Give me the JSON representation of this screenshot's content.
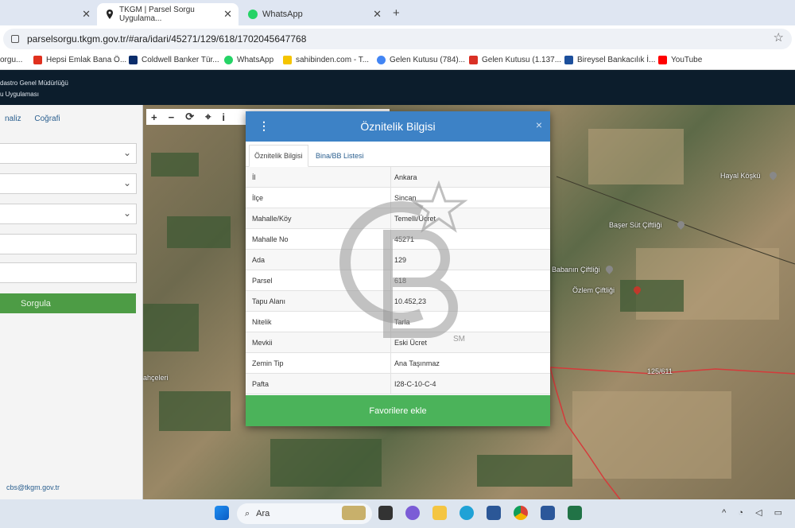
{
  "browser": {
    "tabs": [
      {
        "label": "",
        "active": false
      },
      {
        "label": "TKGM | Parsel Sorgu Uygulama...",
        "active": true
      },
      {
        "label": "WhatsApp",
        "active": false
      }
    ],
    "new_tab": "+",
    "close_glyph": "✕",
    "url": "parselsorgu.tkgm.gov.tr/#ara/idari/45271/129/618/1702045647768",
    "star": "☆",
    "bookmarks": [
      {
        "label": "orgu...",
        "color": "#888"
      },
      {
        "label": "Hepsi Emlak Bana Ö...",
        "color": "#e0301e"
      },
      {
        "label": "Coldwell Banker Tür...",
        "color": "#0b2d6b"
      },
      {
        "label": "WhatsApp",
        "color": "#25d366"
      },
      {
        "label": "sahibinden.com - T...",
        "color": "#f5c400"
      },
      {
        "label": "Gelen Kutusu (784)...",
        "color": "#4285f4"
      },
      {
        "label": "Gelen Kutusu (1.137...",
        "color": "#d93025"
      },
      {
        "label": "Bireysel Bankacılık İ...",
        "color": "#1c4f9c"
      },
      {
        "label": "YouTube",
        "color": "#ff0000"
      }
    ]
  },
  "app": {
    "header_line1": "dastro Genel Müdürlüğü",
    "header_line2": "u Uygulaması",
    "sidebar_tabs": [
      "naliz",
      "Coğrafi"
    ],
    "chevron": "⌄",
    "search_button": "Sorgula",
    "contact_email": "cbs@tkgm.gov.tr"
  },
  "map": {
    "tools": [
      "+",
      "−",
      "⟳",
      "⌖",
      "i"
    ],
    "labels": [
      "Hayal Köşkü",
      "Başer Süt Çiftliği",
      "Babanın Çiftliği",
      "Özlem Çiftliği",
      "125/611",
      "ahçeleri"
    ]
  },
  "modal": {
    "menu_glyph": "⋮",
    "title": "Öznitelik Bilgisi",
    "close": "×",
    "tabs": [
      "Öznitelik Bilgisi",
      "Bina/BB Listesi"
    ],
    "rows": [
      {
        "key": "İl",
        "value": "Ankara"
      },
      {
        "key": "İlçe",
        "value": "Sincan"
      },
      {
        "key": "Mahalle/Köy",
        "value": "Temelli/Ücret"
      },
      {
        "key": "Mahalle No",
        "value": "45271"
      },
      {
        "key": "Ada",
        "value": "129"
      },
      {
        "key": "Parsel",
        "value": "618"
      },
      {
        "key": "Tapu Alanı",
        "value": "10.452,23"
      },
      {
        "key": "Nitelik",
        "value": "Tarla"
      },
      {
        "key": "Mevkii",
        "value": "Eski Ücret"
      },
      {
        "key": "Zemin Tip",
        "value": "Ana Taşınmaz"
      },
      {
        "key": "Pafta",
        "value": "I28-C-10-C-4"
      }
    ],
    "action_button": "Favorilere ekle"
  },
  "watermark": {
    "text": "CB",
    "mark": "SM"
  },
  "taskbar": {
    "search_placeholder": "Ara",
    "tray": "^ ◔ ◁ ▭"
  }
}
